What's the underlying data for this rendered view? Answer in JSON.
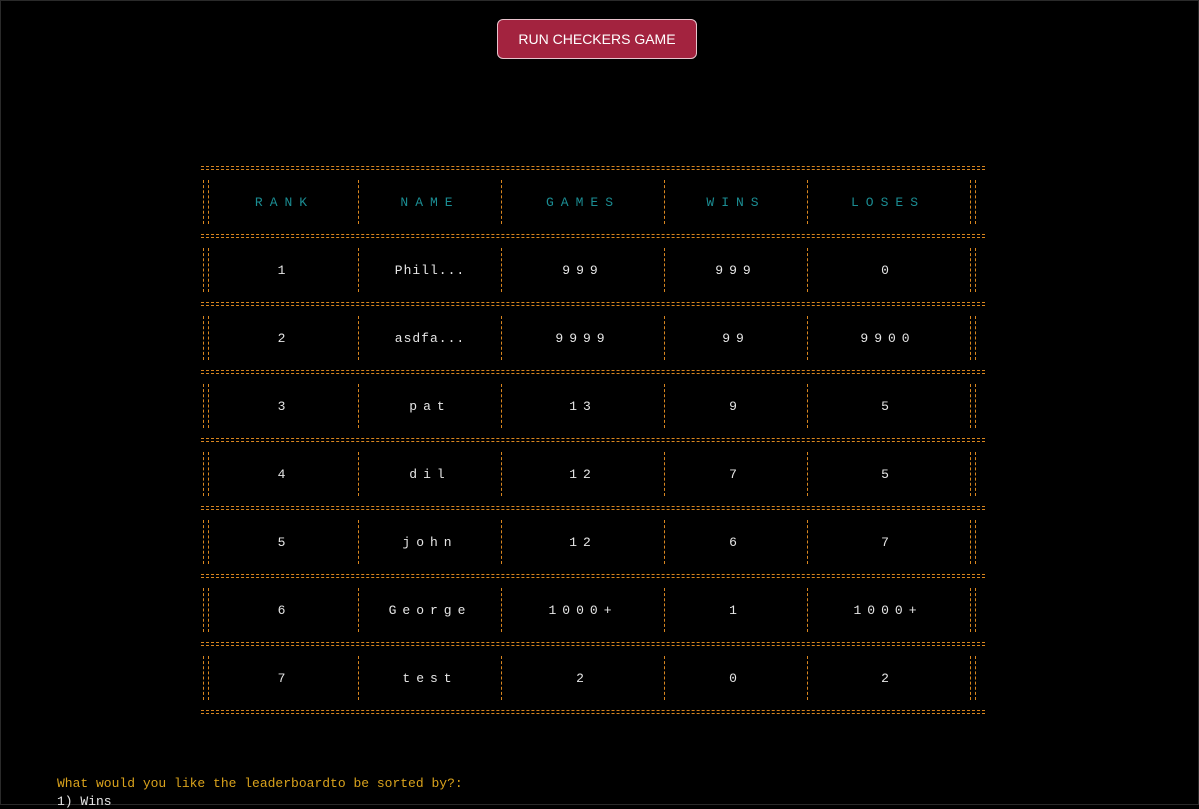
{
  "run_button": {
    "label": "RUN CHECKERS GAME"
  },
  "leaderboard": {
    "headers": [
      "RANK",
      "NAME",
      "GAMES",
      "WINS",
      "LOSES"
    ],
    "rows": [
      [
        "1",
        "Phill...",
        "999",
        "999",
        "0"
      ],
      [
        "2",
        "asdfa...",
        "9999",
        "99",
        "9900"
      ],
      [
        "3",
        "pat",
        "13",
        "9",
        "5"
      ],
      [
        "4",
        "dil",
        "12",
        "7",
        "5"
      ],
      [
        "5",
        "john",
        "12",
        "6",
        "7"
      ],
      [
        "6",
        "George",
        "1000+",
        "1",
        "1000+"
      ],
      [
        "7",
        "test",
        "2",
        "0",
        "2"
      ]
    ]
  },
  "terminal": {
    "prompt": "What would you like the leaderboardto be sorted by?:",
    "option_1": "1) Wins"
  },
  "colors": {
    "background": "#000000",
    "border_ascii": "#d9861f",
    "header_text": "#1b8d93",
    "prompt_text": "#d9a21c",
    "button_bg": "#a3233f"
  }
}
